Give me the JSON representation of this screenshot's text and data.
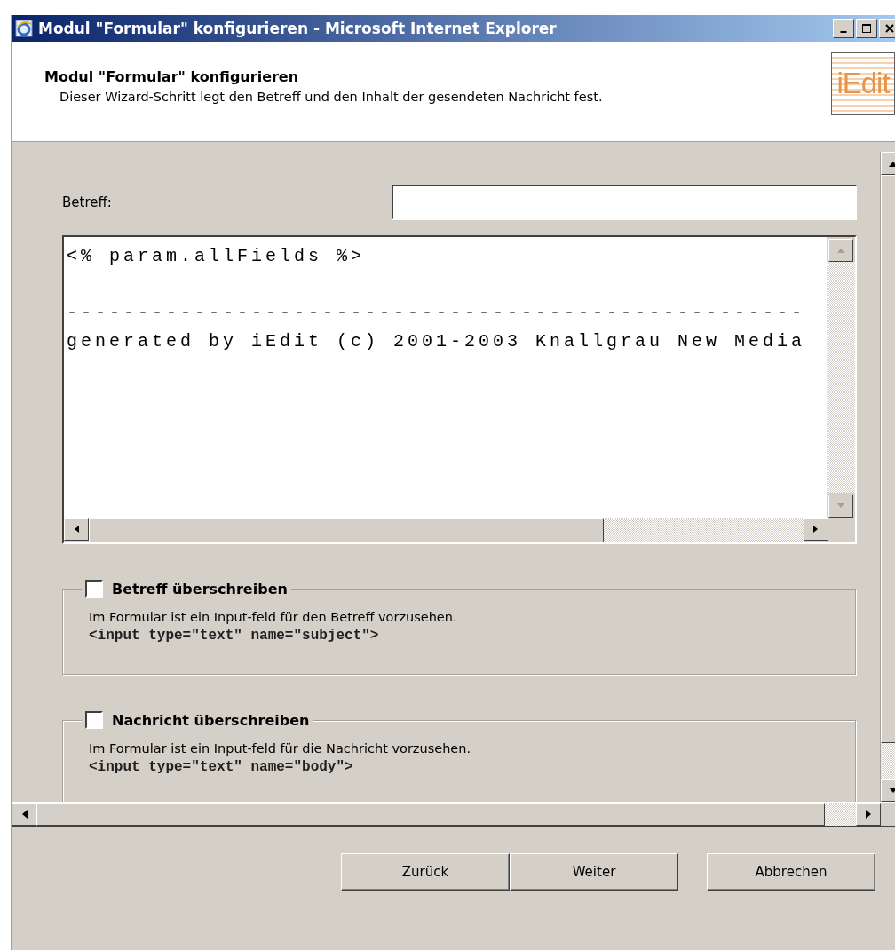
{
  "window": {
    "title": "Modul \"Formular\" konfigurieren - Microsoft Internet Explorer"
  },
  "header": {
    "title": "Modul \"Formular\" konfigurieren",
    "description": "Dieser Wizard-Schritt legt den Betreff und den Inhalt der gesendeten Nachricht fest.",
    "logo": "iEdit"
  },
  "subject": {
    "label": "Betreff:"
  },
  "message": {
    "text": "<% param.allFields %>\n\n----------------------------------------------------\ngenerated by iEdit (c) 2001-2003 Knallgrau New Media"
  },
  "options": [
    {
      "label": "Betreff überschreiben",
      "checked": false,
      "description": "Im Formular ist ein Input-feld für den Betreff vorzusehen.",
      "code": "<input type=\"text\" name=\"subject\">"
    },
    {
      "label": "Nachricht überschreiben",
      "checked": false,
      "description": "Im Formular ist ein Input-feld für die Nachricht vorzusehen.",
      "code": "<input type=\"text\" name=\"body\">"
    }
  ],
  "buttons": [
    "Zurück",
    "Weiter",
    "Abbrechen"
  ]
}
